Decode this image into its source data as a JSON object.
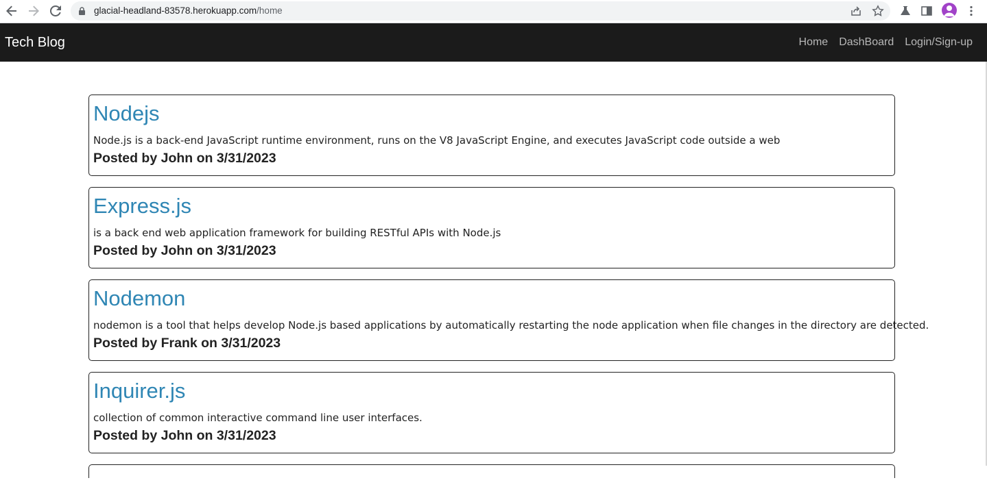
{
  "browser": {
    "url_host": "glacial-headland-83578.herokuapp.com",
    "url_path": "/home",
    "back_icon": "arrow-left-icon",
    "forward_icon": "arrow-right-icon",
    "reload_icon": "reload-icon",
    "share_icon": "share-icon",
    "bookmark_icon": "star-icon",
    "labs_icon": "flask-icon",
    "sidepanel_icon": "side-panel-icon",
    "menu_icon": "kebab-menu-icon"
  },
  "navbar": {
    "brand": "Tech Blog",
    "links": [
      "Home",
      "DashBoard",
      "Login/Sign-up"
    ],
    "background": "#1b1b1b"
  },
  "posts": [
    {
      "title": "Nodejs",
      "body": "Node.js is a back-end JavaScript runtime environment, runs on the V8 JavaScript Engine, and executes JavaScript code outside a web",
      "meta": "Posted by John on 3/31/2023"
    },
    {
      "title": "Express.js",
      "body": "is a back end web application framework for building RESTful APIs with Node.js",
      "meta": "Posted by John on 3/31/2023"
    },
    {
      "title": "Nodemon",
      "body": "nodemon is a tool that helps develop Node.js based applications by automatically restarting the node application when file changes in the directory are detected.",
      "meta": "Posted by Frank on 3/31/2023"
    },
    {
      "title": "Inquirer.js",
      "body": "collection of common interactive command line user interfaces.",
      "meta": "Posted by John on 3/31/2023"
    }
  ],
  "colors": {
    "title_link": "#2f86b4",
    "avatar": "#a142c8"
  }
}
